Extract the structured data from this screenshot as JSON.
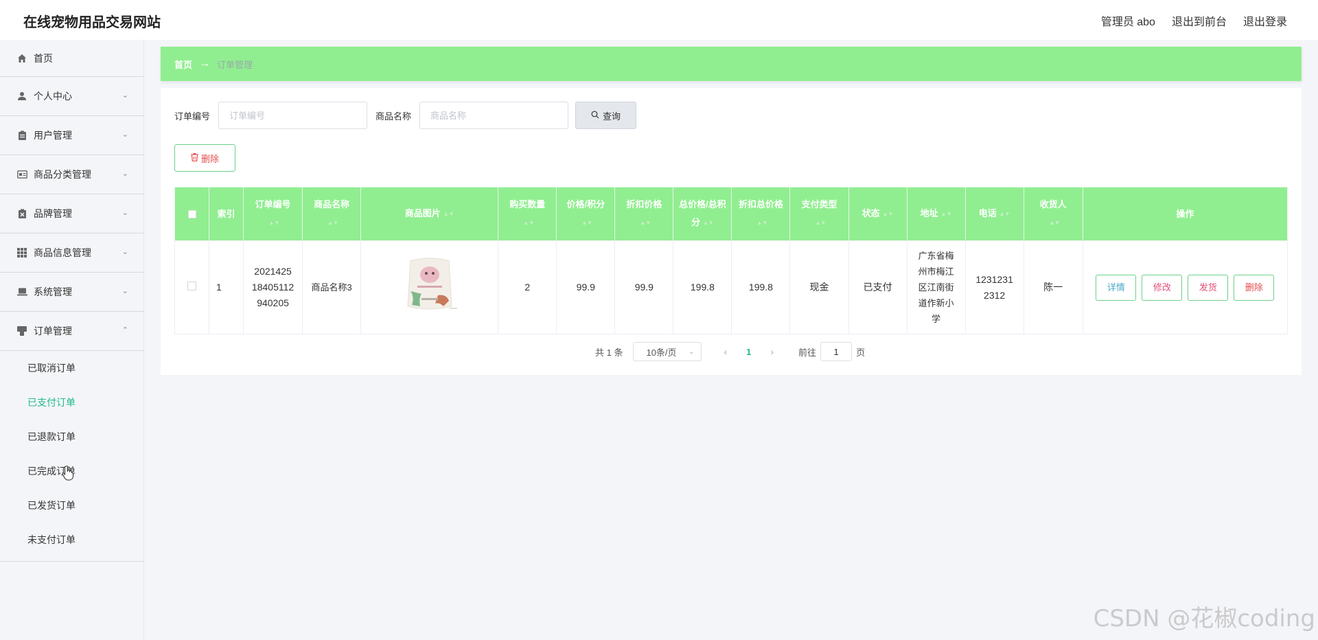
{
  "header": {
    "site_title": "在线宠物用品交易网站",
    "user_label": "管理员 abo",
    "to_front": "退出到前台",
    "logout": "退出登录"
  },
  "sidebar": {
    "items": [
      {
        "label": "首页",
        "icon": "home-icon"
      },
      {
        "label": "个人中心",
        "icon": "user-icon"
      },
      {
        "label": "用户管理",
        "icon": "clipboard-icon"
      },
      {
        "label": "商品分类管理",
        "icon": "id-card-icon"
      },
      {
        "label": "品牌管理",
        "icon": "clipboard-x-icon"
      },
      {
        "label": "商品信息管理",
        "icon": "grid-icon"
      },
      {
        "label": "系统管理",
        "icon": "laptop-icon"
      },
      {
        "label": "订单管理",
        "icon": "order-icon"
      }
    ],
    "sub_items": [
      "已取消订单",
      "已支付订单",
      "已退款订单",
      "已完成订单",
      "已发货订单",
      "未支付订单"
    ],
    "active_sub": "已支付订单"
  },
  "breadcrumb": {
    "home": "首页",
    "arrow": "→",
    "current": "订单管理"
  },
  "search": {
    "order_no_label": "订单编号",
    "order_no_placeholder": "订单编号",
    "product_label": "商品名称",
    "product_placeholder": "商品名称",
    "query_button": "查询"
  },
  "toolbar": {
    "delete_label": "删除"
  },
  "table": {
    "headers": {
      "index": "索引",
      "order_no": "订单编号",
      "product_name": "商品名称",
      "product_image": "商品图片",
      "quantity": "购买数量",
      "price": "价格/积分",
      "discount_price": "折扣价格",
      "total_price": "总价格/总积分",
      "discount_total": "折扣总价格",
      "pay_type": "支付类型",
      "status": "状态",
      "address": "地址",
      "phone": "电话",
      "receiver": "收货人",
      "actions": "操作"
    },
    "rows": [
      {
        "index": "1",
        "order_no": "202142518405112940205",
        "product_name": "商品名称3",
        "quantity": "2",
        "price": "99.9",
        "discount_price": "99.9",
        "total_price": "199.8",
        "discount_total": "199.8",
        "pay_type": "现金",
        "status": "已支付",
        "address": "广东省梅州市梅江区江南街道作新小学",
        "phone": "12312312312",
        "receiver": "陈一"
      }
    ],
    "action_labels": {
      "detail": "详情",
      "edit": "修改",
      "ship": "发货",
      "delete": "删除"
    }
  },
  "pagination": {
    "total_text": "共 1 条",
    "page_size": "10条/页",
    "current_page": "1",
    "goto_prefix": "前往",
    "goto_value": "1",
    "goto_suffix": "页"
  },
  "watermark": "CSDN @花椒coding",
  "colors": {
    "accent_green": "#90ee90",
    "active_teal": "#20b98e",
    "danger_red": "#e54d4d"
  }
}
